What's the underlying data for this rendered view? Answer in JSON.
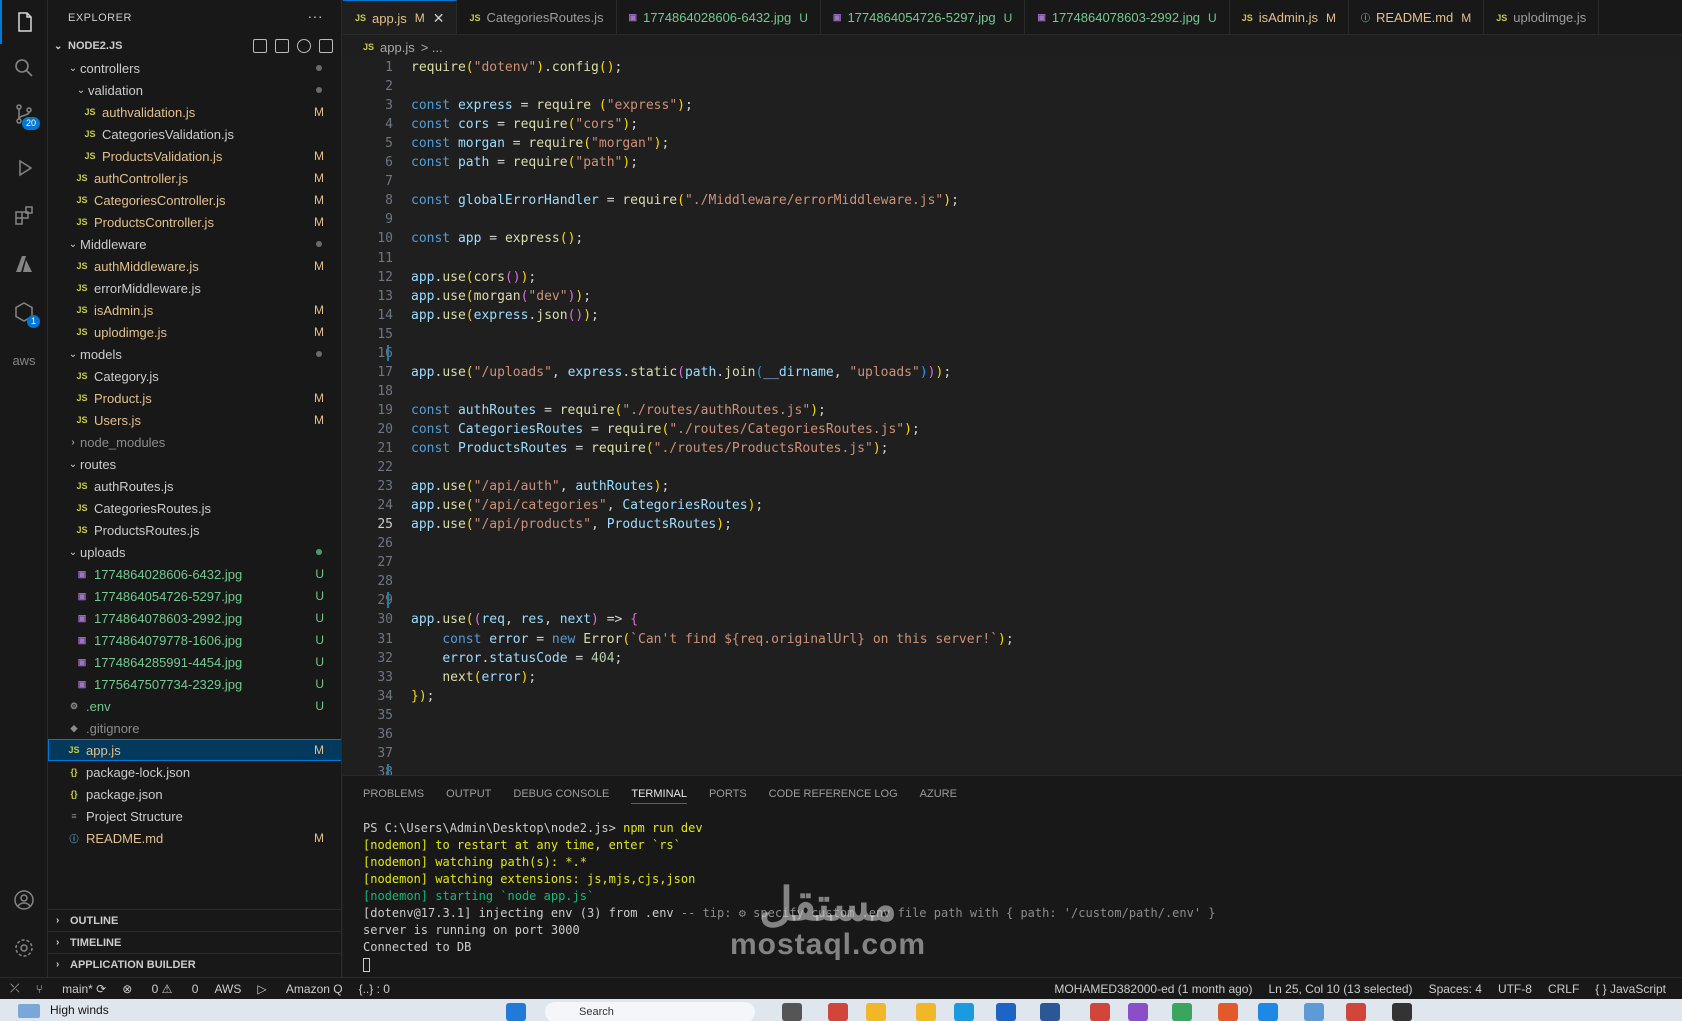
{
  "sidebar": {
    "title": "EXPLORER",
    "project": "NODE2.JS",
    "tree": [
      {
        "label": "controllers",
        "status": "",
        "kind": "dir"
      },
      {
        "label": "validation",
        "status": "",
        "kind": "dir"
      },
      {
        "label": "authvalidation.js",
        "status": "M",
        "kind": "js"
      },
      {
        "label": "CategoriesValidation.js",
        "status": "",
        "kind": "js"
      },
      {
        "label": "ProductsValidation.js",
        "status": "M",
        "kind": "js"
      },
      {
        "label": "authController.js",
        "status": "M",
        "kind": "js"
      },
      {
        "label": "CategoriesController.js",
        "status": "M",
        "kind": "js"
      },
      {
        "label": "ProductsController.js",
        "status": "M",
        "kind": "js"
      },
      {
        "label": "Middleware",
        "status": "",
        "kind": "dir"
      },
      {
        "label": "authMiddleware.js",
        "status": "M",
        "kind": "js"
      },
      {
        "label": "errorMiddleware.js",
        "status": "",
        "kind": "js"
      },
      {
        "label": "isAdmin.js",
        "status": "M",
        "kind": "js"
      },
      {
        "label": "uplodimge.js",
        "status": "M",
        "kind": "js"
      },
      {
        "label": "models",
        "status": "",
        "kind": "dir"
      },
      {
        "label": "Category.js",
        "status": "",
        "kind": "js"
      },
      {
        "label": "Product.js",
        "status": "M",
        "kind": "js"
      },
      {
        "label": "Users.js",
        "status": "M",
        "kind": "js"
      },
      {
        "label": "node_modules",
        "status": "",
        "kind": "dir"
      },
      {
        "label": "routes",
        "status": "",
        "kind": "dir"
      },
      {
        "label": "authRoutes.js",
        "status": "",
        "kind": "js"
      },
      {
        "label": "CategoriesRoutes.js",
        "status": "",
        "kind": "js"
      },
      {
        "label": "ProductsRoutes.js",
        "status": "",
        "kind": "js"
      },
      {
        "label": "uploads",
        "status": "",
        "kind": "dir"
      },
      {
        "label": "1774864028606-6432.jpg",
        "status": "U",
        "kind": "img"
      },
      {
        "label": "1774864054726-5297.jpg",
        "status": "U",
        "kind": "img"
      },
      {
        "label": "1774864078603-2992.jpg",
        "status": "U",
        "kind": "img"
      },
      {
        "label": "1774864079778-1606.jpg",
        "status": "U",
        "kind": "img"
      },
      {
        "label": "1774864285991-4454.jpg",
        "status": "U",
        "kind": "img"
      },
      {
        "label": "1775647507734-2329.jpg",
        "status": "U",
        "kind": "img"
      },
      {
        "label": ".env",
        "status": "U",
        "kind": "gear"
      },
      {
        "label": ".gitignore",
        "status": "",
        "kind": "git"
      },
      {
        "label": "app.js",
        "status": "M",
        "kind": "js"
      },
      {
        "label": "package-lock.json",
        "status": "",
        "kind": "json"
      },
      {
        "label": "package.json",
        "status": "",
        "kind": "json"
      },
      {
        "label": "Project Structure",
        "status": "",
        "kind": "txt"
      },
      {
        "label": "README.md",
        "status": "M",
        "kind": "md"
      }
    ],
    "outline": "OUTLINE",
    "timeline": "TIMELINE",
    "app_builder": "APPLICATION BUILDER"
  },
  "activity": {
    "scm_badge": "20",
    "ext_badge": "1",
    "aws_label": "aws"
  },
  "tabs": [
    {
      "label": "app.js",
      "status": "M",
      "icon": "JS"
    },
    {
      "label": "CategoriesRoutes.js",
      "status": "",
      "icon": "JS"
    },
    {
      "label": "1774864028606-6432.jpg",
      "status": "U",
      "icon": "IMG"
    },
    {
      "label": "1774864054726-5297.jpg",
      "status": "U",
      "icon": "IMG"
    },
    {
      "label": "1774864078603-2992.jpg",
      "status": "U",
      "icon": "IMG"
    },
    {
      "label": "isAdmin.js",
      "status": "M",
      "icon": "JS"
    },
    {
      "label": "README.md",
      "status": "M",
      "icon": "i"
    },
    {
      "label": "uplodimge.js",
      "status": "",
      "icon": "JS"
    }
  ],
  "breadcrumb": {
    "file": "app.js",
    "rest": "> ..."
  },
  "editor": {
    "current_line": 25,
    "lines": [
      "require(\"dotenv\").config();",
      "",
      "const express = require (\"express\");",
      "const cors = require(\"cors\");",
      "const morgan = require(\"morgan\");",
      "const path = require(\"path\");",
      "",
      "const globalErrorHandler = require(\"./Middleware/errorMiddleware.js\");",
      "",
      "const app = express();",
      "",
      "app.use(cors());",
      "app.use(morgan(\"dev\"));",
      "app.use(express.json());",
      "",
      "",
      "app.use(\"/uploads\", express.static(path.join(__dirname, \"uploads\")));",
      "",
      "const authRoutes = require(\"./routes/authRoutes.js\");",
      "const CategoriesRoutes = require(\"./routes/CategoriesRoutes.js\");",
      "const ProductsRoutes = require(\"./routes/ProductsRoutes.js\");",
      "",
      "app.use(\"/api/auth\", authRoutes);",
      "app.use(\"/api/categories\", CategoriesRoutes);",
      "app.use(\"/api/products\", ProductsRoutes);",
      "",
      "",
      "",
      "",
      "app.use((req, res, next) => {",
      "    const error = new Error(`Can't find ${req.originalUrl} on this server!`);",
      "    error.statusCode = 404;",
      "    next(error);",
      "});",
      "",
      "",
      "",
      ""
    ]
  },
  "panel": {
    "tabs": [
      "PROBLEMS",
      "OUTPUT",
      "DEBUG CONSOLE",
      "TERMINAL",
      "PORTS",
      "CODE REFERENCE LOG",
      "AZURE"
    ],
    "active_tab": "TERMINAL",
    "terminal": [
      {
        "text": "PS C:\\Users\\Admin\\Desktop\\node2.js> npm run dev",
        "style": "prompt"
      },
      {
        "text": "[nodemon] to restart at any time, enter `rs`",
        "style": "yellow"
      },
      {
        "text": "[nodemon] watching path(s): *.*",
        "style": "yellow"
      },
      {
        "text": "[nodemon] watching extensions: js,mjs,cjs,json",
        "style": "yellow"
      },
      {
        "text": "[nodemon] starting `node app.js`",
        "style": "green"
      },
      {
        "text": "[dotenv@17.3.1] injecting env (3) from .env -- tip: ⚙ specify custom .env file path with { path: '/custom/path/.env' }",
        "style": "dotenv"
      },
      {
        "text": "server is running on port 3000",
        "style": "white"
      },
      {
        "text": "Connected to DB",
        "style": "white"
      }
    ]
  },
  "statusbar": {
    "branch": "main*",
    "errors": "0",
    "warnings": "0",
    "aws": "AWS",
    "amazonq": "Amazon Q",
    "braces": "{..} : 0",
    "blame": "MOHAMED382000-ed (1 month ago)",
    "position": "Ln 25, Col 10 (13 selected)",
    "spaces": "Spaces: 4",
    "encoding": "UTF-8",
    "eol": "CRLF",
    "language": "{ } JavaScript"
  },
  "taskbar": {
    "weather": "High winds",
    "search": "Search"
  },
  "watermark": {
    "arabic": "مستقل",
    "latin": "mostaql.com"
  },
  "colors": {
    "accent": "#0078d4",
    "modified": "#e2c08d",
    "untracked": "#73c991",
    "background": "#1f1f1f"
  }
}
